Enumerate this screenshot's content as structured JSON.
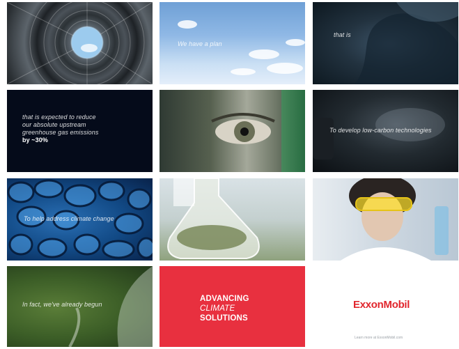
{
  "tiles": [
    {
      "caption": ""
    },
    {
      "caption": "We have a plan"
    },
    {
      "caption": "that is"
    },
    {
      "caption_lines": [
        "that is expected to reduce",
        "our absolute upstream",
        "greenhouse gas emissions"
      ],
      "caption_emphasis": "by ~30%"
    },
    {
      "caption": ""
    },
    {
      "caption": "To develop low-carbon technologies"
    },
    {
      "caption": "To help address climate change"
    },
    {
      "caption": ""
    },
    {
      "caption": ""
    },
    {
      "caption": "In fact, we've already begun"
    },
    {
      "headline": [
        "ADVANCING",
        "CLIMATE",
        "SOLUTIONS"
      ]
    },
    {
      "brand": "ExxonMobil",
      "footer": "Learn more at ExxonMobil.com"
    }
  ],
  "colors": {
    "brand_red": "#e1262d",
    "panel_red": "#e8303f"
  }
}
